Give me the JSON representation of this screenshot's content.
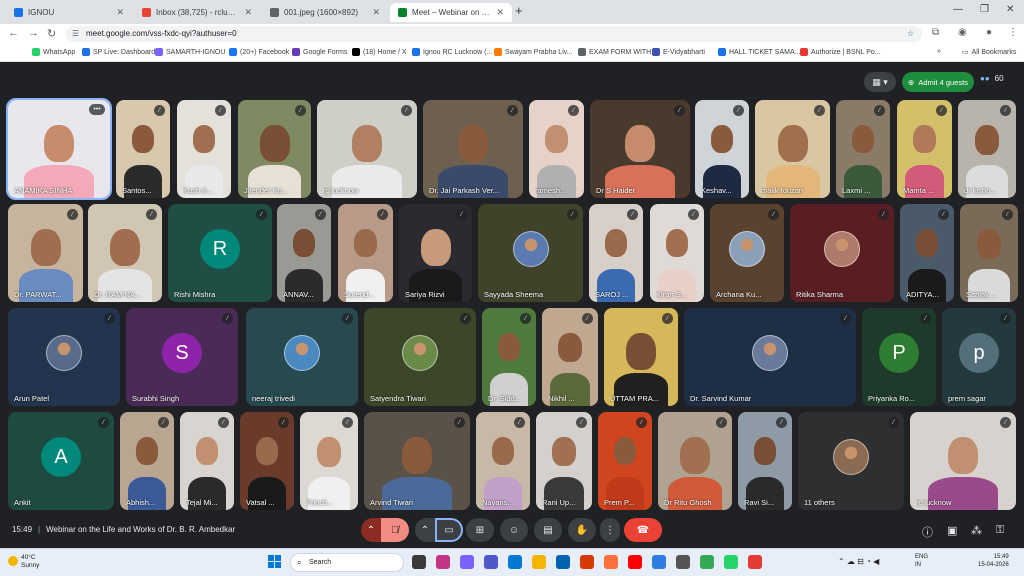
{
  "browser": {
    "tabs": [
      {
        "label": "IGNOU",
        "color": "#1a73e8"
      },
      {
        "label": "Inbox (38,725) - rclucknow@ign",
        "color": "#ea4335"
      },
      {
        "label": "001.jpeg (1600×892)",
        "color": "#5f6368"
      },
      {
        "label": "Meet – Webinar on the Life",
        "color": "#00832d"
      }
    ],
    "url": "meet.google.com/vss-fxdc-qyi?authuser=0",
    "bookmarks": [
      {
        "label": "WhatsApp",
        "color": "#25d366"
      },
      {
        "label": "SP Live: Dashboard",
        "color": "#1a73e8"
      },
      {
        "label": "SAMARTH-IGNOU",
        "color": "#7b61ff"
      },
      {
        "label": "(20+) Facebook",
        "color": "#1877f2"
      },
      {
        "label": "Google Forms",
        "color": "#673ab7"
      },
      {
        "label": "(18) Home / X",
        "color": "#000000"
      },
      {
        "label": "Ignou RC Lucknow (...",
        "color": "#1a73e8"
      },
      {
        "label": "Swayam Prabha Liv...",
        "color": "#f57c00"
      },
      {
        "label": "EXAM FORM WITH...",
        "color": "#5f6368"
      },
      {
        "label": "E-Vidyabharti",
        "color": "#3f51b5"
      },
      {
        "label": "HALL TICKET SAMA...",
        "color": "#1a73e8"
      },
      {
        "label": "Authorize | BSNL Po...",
        "color": "#e53935"
      }
    ],
    "all_bookmarks": "All Bookmarks"
  },
  "meet": {
    "admit_label": "Admit 4 guests",
    "people_count": "60",
    "meeting_time": "15:49",
    "meeting_title": "Webinar on the Life and Works of Dr. B. R. Ambedkar",
    "tiles": [
      {
        "name": "ANAMIKA SINHA",
        "bg": "#e9e7ee",
        "skin": "#c68c6c",
        "cloth": "#f4a9b8"
      },
      {
        "name": "Santos...",
        "bg": "#d8c8ae",
        "skin": "#8b5a3c",
        "cloth": "#2b2b2b"
      },
      {
        "name": "Kush K...",
        "bg": "#e4e0da",
        "skin": "#a06e50",
        "cloth": "#e8e8e8"
      },
      {
        "name": "Jitender Ku...",
        "bg": "#7f8a62",
        "skin": "#7a4e34",
        "cloth": "#e6e0d6"
      },
      {
        "name": "rc lucknow",
        "bg": "#cfcfc8",
        "skin": "#b08060",
        "cloth": "#eaeaea"
      },
      {
        "name": "Dr. Jai Parkash Ver...",
        "bg": "#6d604f",
        "skin": "#8a5a3c",
        "cloth": "#3a4a6a"
      },
      {
        "name": "ramesh...",
        "bg": "#e6d2c8",
        "skin": "#c09070",
        "cloth": "#b0b0b0"
      },
      {
        "name": "Dr S Haider",
        "bg": "#4a3a2e",
        "skin": "#c48c6c",
        "cloth": "#d9705a"
      },
      {
        "name": "Keshav...",
        "bg": "#cfd4d8",
        "skin": "#8a5a3c",
        "cloth": "#1d2a44"
      },
      {
        "name": "malik fouzan",
        "bg": "#d9c6a2",
        "skin": "#a0704c",
        "cloth": "#e3b77a"
      },
      {
        "name": "Laxmi ...",
        "bg": "#8a7a68",
        "skin": "#8a5a3c",
        "cloth": "#3b5a3b"
      },
      {
        "name": "Mamta ...",
        "bg": "#d4c06a",
        "skin": "#b07a5a",
        "cloth": "#d45a7a"
      },
      {
        "name": "dr kisho...",
        "bg": "#b8b4ac",
        "skin": "#8a5a3c",
        "cloth": "#dcdcdc"
      },
      {
        "name": "Dr. PARWAT...",
        "bg": "#c6b49c",
        "skin": "#a06e4e",
        "cloth": "#6a8cc0"
      },
      {
        "name": "Dr. RAM NA...",
        "bg": "#d0c6b4",
        "skin": "#a06e4e",
        "cloth": "#e4e4e4"
      },
      {
        "name": "Rishi Mishra",
        "bg": "#1e4e44",
        "avatar": "R",
        "avatar_color": "#00897b"
      },
      {
        "name": "ANNAV...",
        "bg": "#9a9a94",
        "skin": "#7a4e34",
        "cloth": "#2a2a2a"
      },
      {
        "name": "Surend...",
        "bg": "#b89a88",
        "skin": "#9a6a4c",
        "cloth": "#f0f0f0"
      },
      {
        "name": "Sariya Rizvi",
        "bg": "#2a2a30",
        "skin": "#c89a7c",
        "cloth": "#1a1a1a"
      },
      {
        "name": "Sayyada Sheema",
        "bg": "#40432a",
        "photo": "#5a7ab0"
      },
      {
        "name": "SAROJ ...",
        "bg": "#d8d0c8",
        "skin": "#9a6a4c",
        "cloth": "#3a6ab0"
      },
      {
        "name": "Kiran S...",
        "bg": "#e0dad6",
        "skin": "#a07050",
        "cloth": "#e8d0c8"
      },
      {
        "name": "Archana Ku...",
        "bg": "#5a4230",
        "photo": "#8aa0b8"
      },
      {
        "name": "Ritika Sharma",
        "bg": "#5a1e22",
        "photo": "#b07a6a"
      },
      {
        "name": "ADITYA...",
        "bg": "#4a5a6a",
        "skin": "#7a4e34",
        "cloth": "#1a1a1a"
      },
      {
        "name": "Sanjay ...",
        "bg": "#7a6a58",
        "skin": "#8a5a3c",
        "cloth": "#dadada"
      },
      {
        "name": "Arun Patel",
        "bg": "#23344e",
        "photo": "#5a6a8a"
      },
      {
        "name": "Surabhi Singh",
        "bg": "#4a2a56",
        "avatar": "S",
        "avatar_color": "#8e24aa"
      },
      {
        "name": "neeraj trivedi",
        "bg": "#264a50",
        "photo": "#4a8ac0"
      },
      {
        "name": "Satyendra Tiwari",
        "bg": "#3c4628",
        "photo": "#6a8a4a"
      },
      {
        "name": "Dr. Sidd...",
        "bg": "#4e7a3c",
        "skin": "#8a5a3c",
        "cloth": "#d0d0d0"
      },
      {
        "name": "Nikhil ...",
        "bg": "#c0a890",
        "skin": "#8a5a3c",
        "cloth": "#5a6a3a"
      },
      {
        "name": "UTTAM PRA...",
        "bg": "#d6b85a",
        "skin": "#7a4e34",
        "cloth": "#202020"
      },
      {
        "name": "Dr. Sarvind Kumar",
        "bg": "#1e2e44",
        "photo": "#6a7a9a"
      },
      {
        "name": "Priyanka Ro...",
        "bg": "#1e3a2a",
        "avatar": "P",
        "avatar_color": "#2e7d32"
      },
      {
        "name": "prem sagar",
        "bg": "#23393e",
        "avatar": "p",
        "avatar_color": "#546e7a"
      },
      {
        "name": "Ankit",
        "bg": "#1e4a40",
        "avatar": "A",
        "avatar_color": "#00897b"
      },
      {
        "name": "Abhish...",
        "bg": "#b8a690",
        "skin": "#8a5a3c",
        "cloth": "#3a5a9a"
      },
      {
        "name": "Tejal Mi...",
        "bg": "#d8d4d0",
        "skin": "#c09070",
        "cloth": "#2a2a2a"
      },
      {
        "name": "Vatsal ...",
        "bg": "#6a3a2a",
        "skin": "#9a6a4c",
        "cloth": "#1a1a1a"
      },
      {
        "name": "Princh...",
        "bg": "#dcd8d2",
        "skin": "#c09070",
        "cloth": "#f0f0f0"
      },
      {
        "name": "Arvind Tiwari",
        "bg": "#5a5248",
        "skin": "#8a5a3c",
        "cloth": "#4a6a9a"
      },
      {
        "name": "Nayans...",
        "bg": "#c8b8a8",
        "skin": "#9a6a4c",
        "cloth": "#c0a0c8"
      },
      {
        "name": "Rani Up...",
        "bg": "#d4d0cc",
        "skin": "#a07050",
        "cloth": "#3a3a3a"
      },
      {
        "name": "Prem P...",
        "bg": "#d0441e",
        "skin": "#8a5a3c",
        "cloth": "#c03a1a"
      },
      {
        "name": "Dr Ritu Ghosh",
        "bg": "#b0a290",
        "skin": "#a07050",
        "cloth": "#d05a3a"
      },
      {
        "name": "Ravi Si...",
        "bg": "#8e9aa6",
        "skin": "#7a4e34",
        "cloth": "#2a2a2a"
      },
      {
        "name": "11 others",
        "bg": "#2d2f31",
        "photo": "#8a6a50"
      },
      {
        "name": "rc lucknow",
        "bg": "#d8d2ce",
        "skin": "#c09070",
        "cloth": "#9a4a8a"
      }
    ]
  },
  "taskbar": {
    "temp": "40°C",
    "weather": "Sunny",
    "search_label": "Search",
    "lang1": "ENG",
    "lang2": "IN",
    "time": "15:49",
    "date": "15-04-2026"
  }
}
